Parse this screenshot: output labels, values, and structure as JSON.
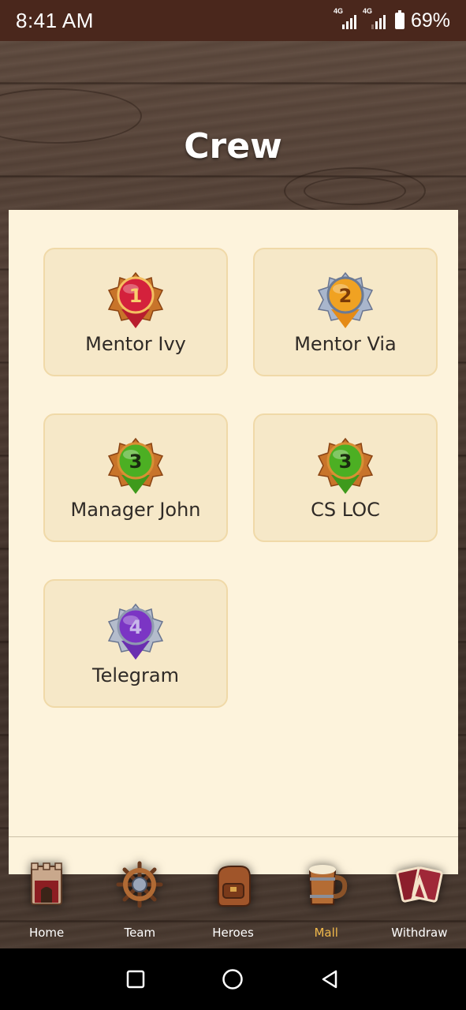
{
  "status_bar": {
    "time": "8:41 AM",
    "network_1": "4G",
    "network_2": "4G",
    "battery": "69%"
  },
  "page": {
    "title": "Crew"
  },
  "contacts": [
    {
      "label": "Mentor Ivy",
      "badge_number": "1",
      "badge_icon": "rank-1-badge-icon",
      "gem_color": "#d4213c"
    },
    {
      "label": "Mentor Via",
      "badge_number": "2",
      "badge_icon": "rank-2-badge-icon",
      "gem_color": "#f0a222"
    },
    {
      "label": "Manager John",
      "badge_number": "3",
      "badge_icon": "rank-3-badge-icon",
      "gem_color": "#4caf23"
    },
    {
      "label": "CS LOC",
      "badge_number": "3",
      "badge_icon": "rank-3-badge-icon",
      "gem_color": "#4caf23"
    },
    {
      "label": "Telegram",
      "badge_number": "4",
      "badge_icon": "rank-4-badge-icon",
      "gem_color": "#7b35c4"
    }
  ],
  "bottom_nav": {
    "active": "Mall",
    "active_color": "#f0b84a",
    "items": [
      {
        "label": "Home",
        "icon": "tower-icon"
      },
      {
        "label": "Team",
        "icon": "ship-wheel-icon"
      },
      {
        "label": "Heroes",
        "icon": "backpack-icon"
      },
      {
        "label": "Mall",
        "icon": "mug-icon"
      },
      {
        "label": "Withdraw",
        "icon": "cards-icon"
      }
    ]
  },
  "system_nav": {
    "icons": [
      "recents-icon",
      "home-circle-icon",
      "back-triangle-icon"
    ]
  }
}
